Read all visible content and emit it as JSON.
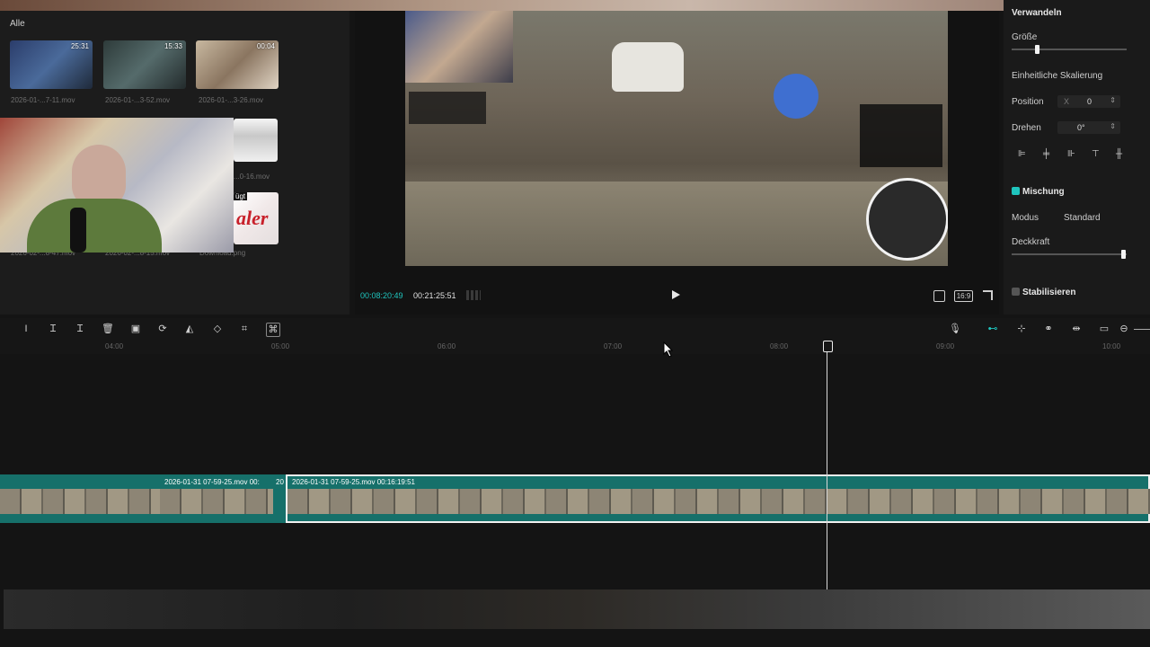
{
  "media": {
    "filter_label": "Alle",
    "items": [
      {
        "name": "2026-01-...7-11.mov",
        "duration": "25:31"
      },
      {
        "name": "2026-01-...3-52.mov",
        "duration": "15:33"
      },
      {
        "name": "2026-01-...3-26.mov",
        "duration": "00:04"
      },
      {
        "name": "2026-02-...8-47.mov",
        "duration": ""
      },
      {
        "name": "2026-02-...8-15.mov",
        "duration": ""
      },
      {
        "name": "...0-16.mov",
        "duration": ""
      },
      {
        "name": "Download.png",
        "duration": ""
      }
    ],
    "overlay_badge": "ügt"
  },
  "preview": {
    "current_time": "00:08:20:49",
    "total_time": "00:21:25:51",
    "aspect_label": "16:9"
  },
  "properties": {
    "transform_title": "Verwandeln",
    "size_label": "Größe",
    "uniform_scale_label": "Einheitliche Skalierung",
    "position_label": "Position",
    "position_axis": "X",
    "position_value": "0",
    "rotate_label": "Drehen",
    "rotate_value": "0°",
    "blend_title": "Mischung",
    "mode_label": "Modus",
    "mode_value": "Standard",
    "opacity_label": "Deckkraft",
    "stabilize_title": "Stabilisieren",
    "size_level": 0.22,
    "opacity_level": 0.97
  },
  "timeline": {
    "ruler_ticks": [
      "04:00",
      "05:00",
      "06:00",
      "07:00",
      "08:00",
      "09:00",
      "10:00"
    ],
    "clips": [
      {
        "label": "2026-01-31 07-59-25.mov   00:"
      },
      {
        "label": "20"
      },
      {
        "label": "2026-01-31 07-59-25.mov   00:16:19:51"
      }
    ]
  },
  "colors": {
    "accent": "#1fc4bd",
    "track": "#16706a"
  }
}
